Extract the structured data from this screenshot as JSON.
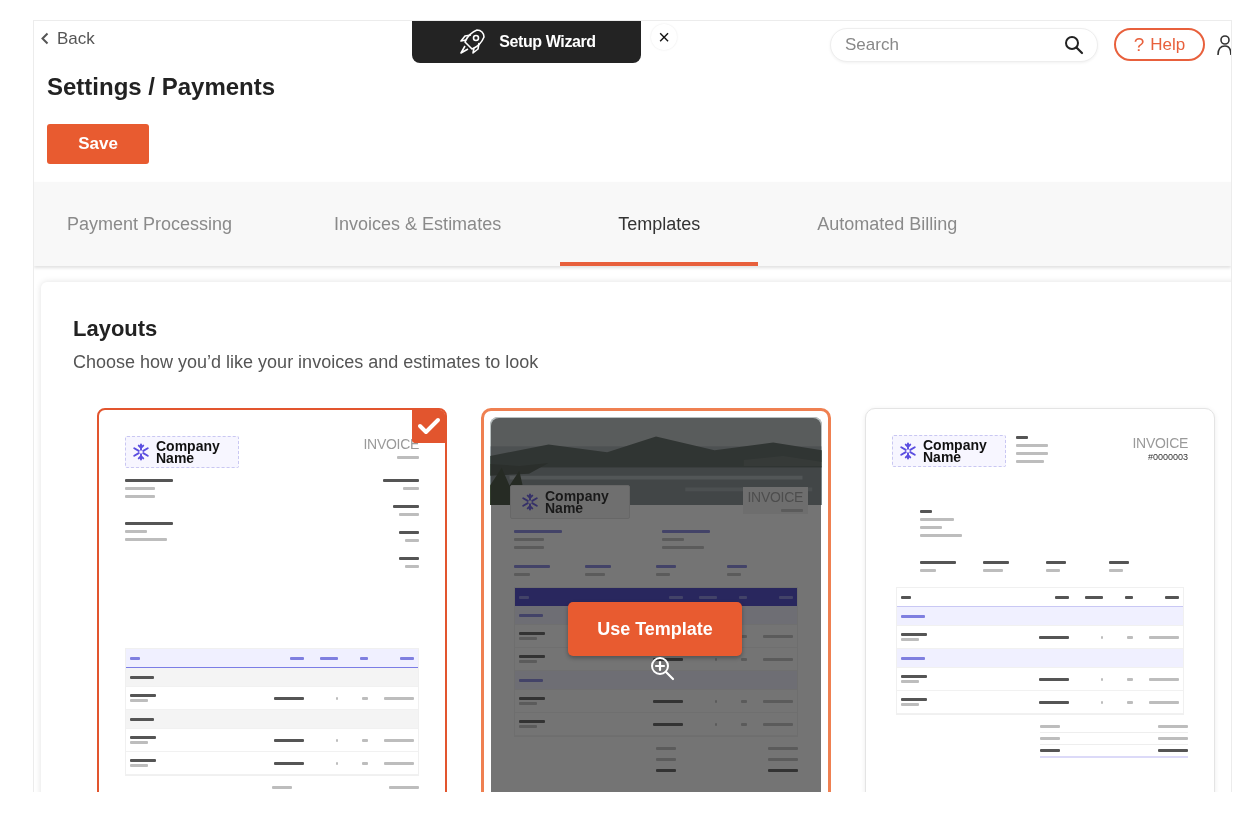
{
  "top_bar": {
    "back": "Back",
    "wizard": "Setup Wizard",
    "close": "×",
    "search": {
      "placeholder": "Search"
    },
    "help": {
      "icon": "?",
      "label": "Help"
    }
  },
  "page_title": "Settings / Payments",
  "save_button": "Save",
  "tabs": [
    {
      "label": "Payment Processing",
      "selected": false
    },
    {
      "label": "Invoices & Estimates",
      "selected": false
    },
    {
      "label": "Templates",
      "selected": true
    },
    {
      "label": "Automated Billing",
      "selected": false
    }
  ],
  "layouts": {
    "title": "Layouts",
    "subtitle": "Choose how you’d like your invoices and estimates to look",
    "templates": [
      {
        "kind": "classic",
        "selected": true,
        "hovered": false,
        "company": "Company Name",
        "doc_title": "INVOICE",
        "rows": [
          {
            "kind": "group"
          },
          {
            "kind": "item"
          },
          {
            "kind": "group"
          },
          {
            "kind": "item"
          },
          {
            "kind": "item"
          }
        ]
      },
      {
        "kind": "banner",
        "selected": false,
        "hovered": true,
        "action": "Use Template",
        "company": "Company Name",
        "doc_title": "INVOICE",
        "rows": [
          {
            "kind": "group"
          },
          {
            "kind": "item"
          },
          {
            "kind": "item"
          },
          {
            "kind": "group"
          },
          {
            "kind": "item"
          },
          {
            "kind": "item"
          }
        ]
      },
      {
        "kind": "modern",
        "selected": false,
        "hovered": false,
        "company": "Company Name",
        "doc_title": "INVOICE",
        "number": "#0000003",
        "rows": [
          {
            "kind": "group"
          },
          {
            "kind": "item"
          },
          {
            "kind": "group"
          },
          {
            "kind": "item"
          },
          {
            "kind": "item"
          }
        ]
      }
    ]
  }
}
